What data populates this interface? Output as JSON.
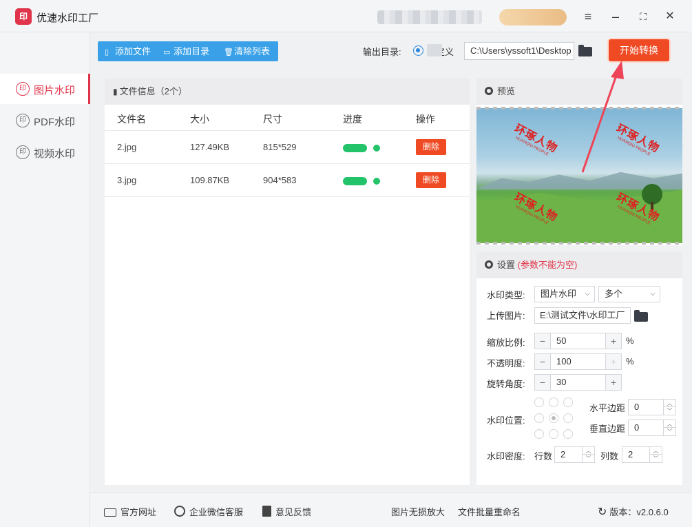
{
  "app": {
    "title": "优速水印工厂",
    "logo_text": "印"
  },
  "window_controls": {
    "menu": "≡",
    "minimize": "–",
    "maximize": "⛶",
    "close": "✕"
  },
  "sidebar": {
    "items": [
      {
        "label": "图片水印",
        "icon": "印",
        "active": true
      },
      {
        "label": "PDF水印",
        "icon": "印",
        "active": false
      },
      {
        "label": "视频水印",
        "icon": "印",
        "active": false
      }
    ]
  },
  "toolbar": {
    "add_file": "添加文件",
    "add_dir": "添加目录",
    "clear_list": "清除列表",
    "output_label": "输出目录:",
    "radio_label": "自定义",
    "output_path": "C:\\Users\\yssoft1\\Desktop",
    "start_button": "开始转换"
  },
  "file_panel": {
    "title": "文件信息（2个）",
    "columns": [
      "文件名",
      "大小",
      "尺寸",
      "进度",
      "操作"
    ],
    "rows": [
      {
        "name": "2.jpg",
        "size": "127.49KB",
        "dims": "815*529",
        "progress": 1.0,
        "action": "删除"
      },
      {
        "name": "3.jpg",
        "size": "109.87KB",
        "dims": "904*583",
        "progress": 1.0,
        "action": "删除"
      }
    ]
  },
  "preview": {
    "title": "预览",
    "watermark_text": "环琢人物",
    "watermark_sub": "HUANQIU PEOPLE"
  },
  "settings": {
    "title": "设置",
    "warning": "(参数不能为空)",
    "watermark_type_label": "水印类型:",
    "watermark_type_value": "图片水印",
    "watermark_count_value": "多个",
    "upload_label": "上传图片:",
    "upload_path": "E:\\测试文件\\水印工厂",
    "scale_label": "缩放比例:",
    "scale_value": "50",
    "opacity_label": "不透明度:",
    "opacity_value": "100",
    "rotate_label": "旋转角度:",
    "rotate_value": "30",
    "percent": "%",
    "position_label": "水印位置:",
    "h_margin_label": "水平边距",
    "h_margin_value": "0",
    "v_margin_label": "垂直边距",
    "v_margin_value": "0",
    "density_label": "水印密度:",
    "rows_label": "行数",
    "rows_value": "2",
    "cols_label": "列数",
    "cols_value": "2"
  },
  "footer": {
    "website": "官方网址",
    "wechat": "企业微信客服",
    "feedback": "意见反馈",
    "lossless": "图片无损放大",
    "rename": "文件批量重命名",
    "version_label": "版本：",
    "version": "v2.0.6.0"
  },
  "colors": {
    "accent": "#e0344a",
    "primary_blue": "#3aa1e8",
    "start_orange": "#ef4a24",
    "progress_green": "#23c36a"
  }
}
